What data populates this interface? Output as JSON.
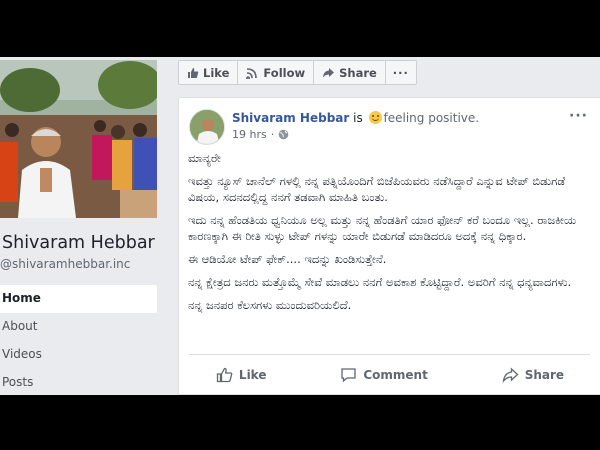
{
  "profile": {
    "name": "Shivaram Hebbar",
    "handle": "@shivaramhebbar.inc"
  },
  "nav": {
    "items": [
      {
        "label": "Home",
        "active": true
      },
      {
        "label": "About"
      },
      {
        "label": "Videos"
      },
      {
        "label": "Posts"
      }
    ]
  },
  "action_bar": {
    "like": "Like",
    "follow": "Follow",
    "share": "Share",
    "more": "···"
  },
  "post": {
    "author": "Shivaram Hebbar",
    "is_text": " is ",
    "feeling": "feeling positive.",
    "time": "19 hrs",
    "dot": "·",
    "menu": "···",
    "paragraphs": [
      "ಮಾನ್ಯರೇ",
      "ಇವತ್ತು ನ್ಯೂಸ್ ಚಾನೆಲ್ ಗಳಲ್ಲಿ ನನ್ನ ಪತ್ನಿಯೊಂದಿಗೆ ಬಿಜೆಪಿಯವರು ನಡೆಸಿದ್ದಾರೆ ಎನ್ನುವ ಟೇಪ್ ಬಿಡುಗಡೆ ವಿಷಯ, ಸದನದಲ್ಲಿದ್ದ ನನಗೆ ತಡವಾಗಿ ಮಾಹಿತಿ ಬಂತು.",
      "ಇದು ನನ್ನ ಹೆಂಡತಿಯ ಧ್ವನಿಯೂ ಅಲ್ಲ ಮತ್ತು ನನ್ನ ಹೆಂಡತಿಗೆ ಯಾರ ಫೋನ್ ಕರೆ ಬಂದೂ ಇಲ್ಲ. ರಾಜಕೀಯ ಕಾರಣಕ್ಕಾಗಿ ಈ ರೀತಿ ಸುಳ್ಳು ಟೇಪ್ ಗಳನ್ನು ಯಾರೇ ಬಿಡುಗಡೆ ಮಾಡಿದರೂ ಅದಕ್ಕೆ ನನ್ನ ಧಿಕ್ಕಾರ.",
      "ಈ ಆಡಿಯೋ ಟೇಪ್ ಫೇಕ್.... ಇದನ್ನು ಖಂಡಿಸುತ್ತೇನೆ.",
      "ನನ್ನ ಕ್ಷೇತ್ರದ ಜನರು ಮತ್ತೊಮ್ಮೆ ಸೇವೆ ಮಾಡಲು ನನಗೆ ಅವಕಾಶ ಕೊಟ್ಟಿದ್ದಾರೆ. ಅವರಿಗೆ ನನ್ನ ಧನ್ಯವಾದಗಳು.",
      "ನನ್ನ ಜನಪರ ಕೆಲಸಗಳು ಮುಂದುವರಿಯಲಿದೆ."
    ],
    "actions": {
      "like": "Like",
      "comment": "Comment",
      "share": "Share"
    }
  },
  "colors": {
    "link": "#365899",
    "page_bg": "#e9ebee",
    "letterbox": "#000000"
  }
}
